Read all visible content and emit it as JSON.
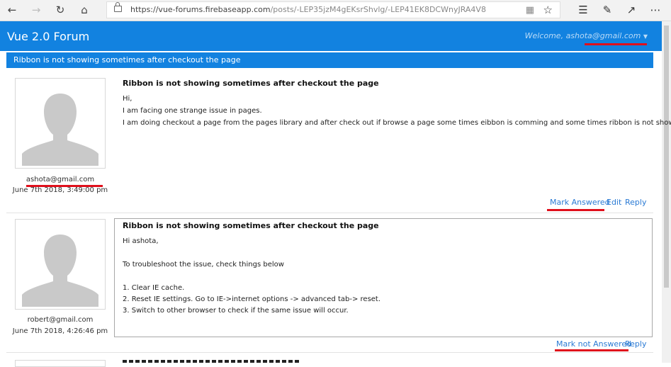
{
  "browser": {
    "url_host": "https://vue-forums.firebaseapp.com",
    "url_path": "/posts/-LEP35jzM4gEKsrShvlg/-LEP41EK8DCWnyJRA4V8"
  },
  "app": {
    "brand": "Vue 2.0 Forum",
    "welcome": "Welcome, ashota@gmail.com"
  },
  "thread": {
    "title": "Ribbon is not showing sometimes after checkout the page"
  },
  "posts": [
    {
      "title": "Ribbon is not showing sometimes after checkout the page",
      "lines": [
        "Hi,",
        "I am facing one strange issue in pages.",
        "I am doing checkout a page from the pages library and after check out if browse a page some times eibbon is comming and some times ribbon is not showing"
      ],
      "author": "ashota@gmail.com",
      "date": "June 7th 2018, 3:49:00 pm",
      "actions": {
        "mark": "Mark Answered",
        "edit": "Edit",
        "reply": "Reply"
      }
    },
    {
      "title": "Ribbon is not showing sometimes after checkout the page",
      "lines": [
        "Hi ashota,",
        "To troubleshoot the issue, check things below",
        "1. Clear IE cache.",
        "2. Reset IE settings. Go to IE->internet options -> advanced tab-> reset.",
        "3. Switch to other browser to check if the same issue will occur."
      ],
      "author": "robert@gmail.com",
      "date": "June 7th 2018, 4:26:46 pm",
      "actions": {
        "mark": "Mark not Answered",
        "reply": "Reply"
      }
    }
  ],
  "colors": {
    "primary": "#1282e0",
    "link": "#2a7ad4",
    "highlight": "#e0101c"
  }
}
